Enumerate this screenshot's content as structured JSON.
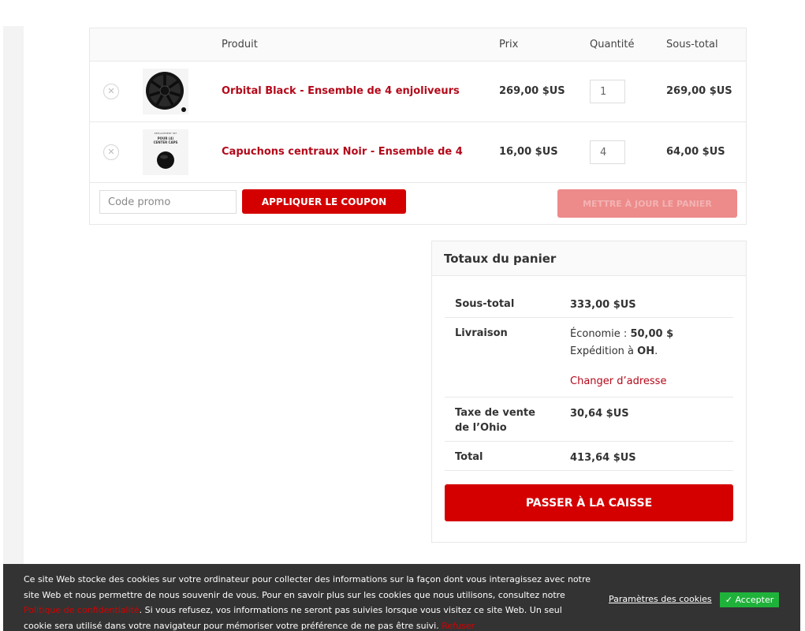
{
  "cart": {
    "headers": {
      "product": "Produit",
      "price": "Prix",
      "quantity": "Quantité",
      "subtotal": "Sous-total"
    },
    "items": [
      {
        "name": "Orbital Black - Ensemble de 4 enjoliveurs",
        "price": "269,00 $US",
        "quantity": "1",
        "subtotal": "269,00 $US"
      },
      {
        "name": "Capuchons centraux Noir - Ensemble de 4",
        "price": "16,00 $US",
        "quantity": "4",
        "subtotal": "64,00 $US"
      }
    ],
    "coupon_placeholder": "Code promo",
    "apply_coupon": "APPLIQUER LE COUPON",
    "update_cart": "METTRE À JOUR LE PANIER"
  },
  "totals": {
    "heading": "Totaux du panier",
    "subtotal_label": "Sous-total",
    "subtotal_value": "333,00 $US",
    "shipping_label": "Livraison",
    "shipping_economy_prefix": "Économie : ",
    "shipping_economy_value": "50,00 $",
    "shipping_to_prefix": "Expédition à ",
    "shipping_to_state": "OH",
    "shipping_to_suffix": ".",
    "change_address": "Changer d’adresse",
    "tax_label": "Taxe de vente de l’Ohio",
    "tax_value": "30,64 $US",
    "total_label": "Total",
    "total_value": "413,64 $US",
    "checkout": "PASSER À LA CAISSE"
  },
  "thumbs": {
    "caps_line1": "REPLACEMENT SET",
    "caps_line2": "POUR (4)",
    "caps_line3": "CENTER CAPS"
  },
  "cookie": {
    "text_before": "Ce site Web stocke des cookies sur votre ordinateur pour collecter des informations sur la façon dont vous interagissez avec notre site Web et nous permettre de nous souvenir de vous. Pour en savoir plus sur les cookies que nous utilisons, consultez notre ",
    "privacy_link": "Politique de confidentialité",
    "text_after": ". Si vous refusez, vos informations ne seront pas suivies lorsque vous visitez ce site Web. Un seul cookie sera utilisé dans votre navigateur pour mémoriser votre préférence de ne pas être suivi. ",
    "refuse_link": "Refuser",
    "settings": "Paramètres des cookies",
    "accept": "Accepter"
  },
  "colors": {
    "accent": "#d40000",
    "link": "#b3091a",
    "accept": "#1fb23a",
    "cookie_bg": "#333333"
  }
}
